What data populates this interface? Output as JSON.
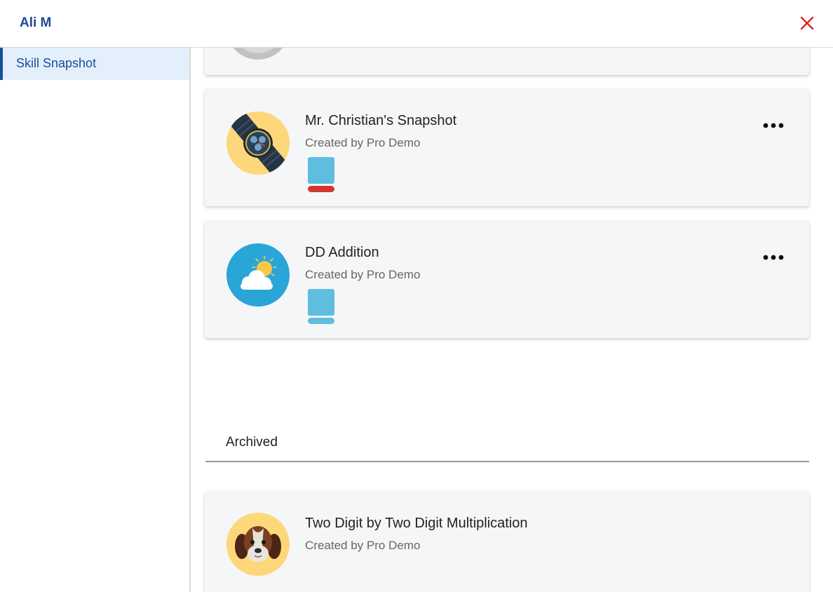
{
  "header": {
    "user_name": "Ali M",
    "close_icon": "close-icon",
    "close_color": "#e02020"
  },
  "sidebar": {
    "items": [
      {
        "label": "Skill Snapshot",
        "active": true
      }
    ]
  },
  "snapshots": [
    {
      "title": "Mr. Christian's Snapshot",
      "creator": "Created by Pro Demo",
      "avatar_icon": "watch-icon",
      "avatar_bg": "#fdd77a",
      "skill_color": "#5fbde0",
      "skill_bar_color": "#d2382f"
    },
    {
      "title": "DD Addition",
      "creator": "Created by Pro Demo",
      "avatar_icon": "sun-cloud-icon",
      "avatar_bg": "#2aa5d8",
      "skill_color": "#5fbde0",
      "skill_bar_color": "#5fbde0"
    }
  ],
  "archived": {
    "tab_label": "Archived",
    "items": [
      {
        "title": "Two Digit by Two Digit Multiplication",
        "creator": "Created by Pro Demo",
        "avatar_icon": "dog-icon",
        "avatar_bg": "#fdd77a"
      }
    ]
  },
  "colors": {
    "brand": "#1a4d99",
    "sidebar_active_bg": "#e3f0fb",
    "card_bg": "#f5f6f7"
  }
}
